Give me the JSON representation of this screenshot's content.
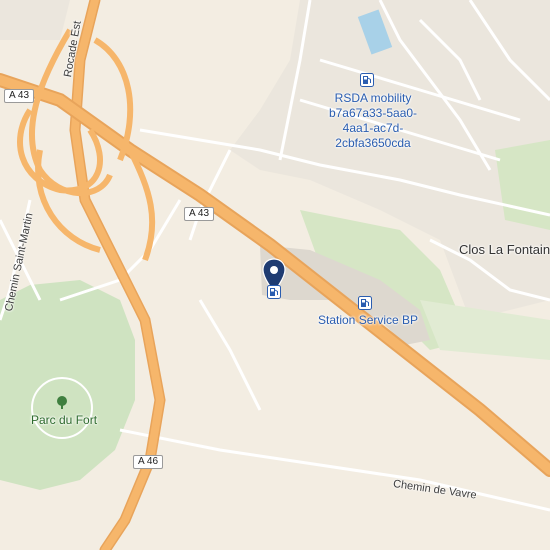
{
  "map": {
    "colors": {
      "land": "#f3ede2",
      "motorway": "#f6b66b",
      "motorway_casing": "#e8a45b",
      "park": "#cfe3c1",
      "residential": "#ebe6dd",
      "minor_road": "#ffffff",
      "water": "#a8d1e8",
      "poi_blue": "#2a5db0",
      "marker_dark": "#1f3c72"
    },
    "shields": {
      "a43_left": "A 43",
      "a43_center": "A 43",
      "a46": "A 46"
    },
    "labels": {
      "rocade_est": "Rocade Est",
      "chemin_saint_martin": "Chemin Saint-Martin",
      "parc_du_fort": "Parc du Fort",
      "clos_la_fontaine": "Clos La Fontain",
      "chemin_de_vavre": "Chemin de Vavre"
    },
    "pois": {
      "rsda": {
        "icon": "fuel-station-icon",
        "line1": "RSDA mobility",
        "line2": "b7a67a33-5aa0-",
        "line3": "4aa1-ac7d-",
        "line4": "2cbfa3650cda"
      },
      "station_bp": {
        "icon": "fuel-station-icon",
        "label": "Station Service BP"
      },
      "selected": {
        "icon": "fuel-station-icon"
      }
    }
  }
}
